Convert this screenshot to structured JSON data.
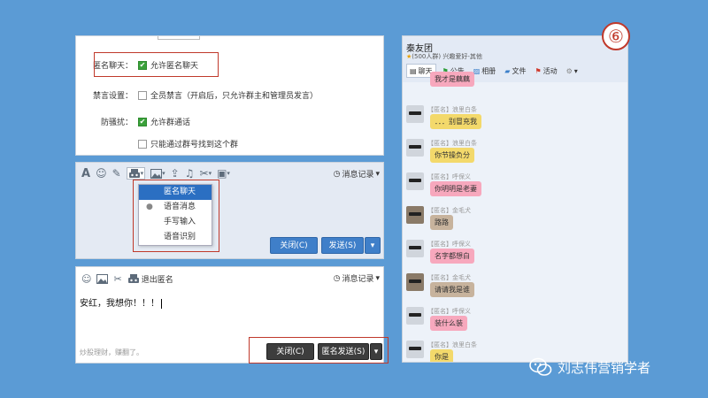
{
  "settings": {
    "anon_label": "匿名聊天：",
    "anon_option": "允许匿名聊天",
    "mute_label": "禁言设置：",
    "mute_option": "全员禁言（开启后，只允许群主和管理员发言）",
    "harass_label": "防骚扰：",
    "harass_option1": "允许群通话",
    "harass_option2": "只能通过群号找到这个群"
  },
  "chat_mid": {
    "history": "消息记录",
    "dropdown": [
      "匿名聊天",
      "语音消息",
      "手写输入",
      "语音识别"
    ],
    "close": "关闭(C)",
    "send": "发送(S)"
  },
  "chat_bot": {
    "exit_anon": "退出匿名",
    "history": "消息记录",
    "typed_text": "安红，我想你！！！",
    "ad_text": "炒股理财，赚翻了。",
    "close": "关闭(C)",
    "send": "匿名发送(S)"
  },
  "group": {
    "name": "秦友团",
    "sub": "(500人群) 兴趣爱好-其他",
    "tabs": [
      "聊天",
      "公告",
      "相册",
      "文件",
      "活动"
    ],
    "step_number": "⑥",
    "messages": [
      {
        "sender": "",
        "text": "我才是藕藕",
        "color": "pink",
        "dark": false
      },
      {
        "sender": "【匿名】浪里白条",
        "text": "．．．别冒充我",
        "color": "yellow",
        "dark": false
      },
      {
        "sender": "【匿名】浪里白条",
        "text": "你节操负分",
        "color": "yellow",
        "dark": false
      },
      {
        "sender": "【匿名】呼保义",
        "text": "你明明是老妻",
        "color": "pink",
        "dark": false
      },
      {
        "sender": "【匿名】金毛犬",
        "text": "路路",
        "color": "tan",
        "dark": true
      },
      {
        "sender": "【匿名】呼保义",
        "text": "名字都想白",
        "color": "pink",
        "dark": false
      },
      {
        "sender": "【匿名】金毛犬",
        "text": "请请我是谁",
        "color": "tan",
        "dark": true
      },
      {
        "sender": "【匿名】呼保义",
        "text": "装什么装",
        "color": "pink",
        "dark": false
      },
      {
        "sender": "【匿名】浪里白条",
        "text": "你是",
        "color": "yellow",
        "dark": false
      }
    ]
  },
  "watermark": "刘志伟营销学者",
  "colors": {
    "background": "#5b9bd5",
    "accent_red": "#c0392b",
    "blue_button": "#3f7fc9"
  }
}
